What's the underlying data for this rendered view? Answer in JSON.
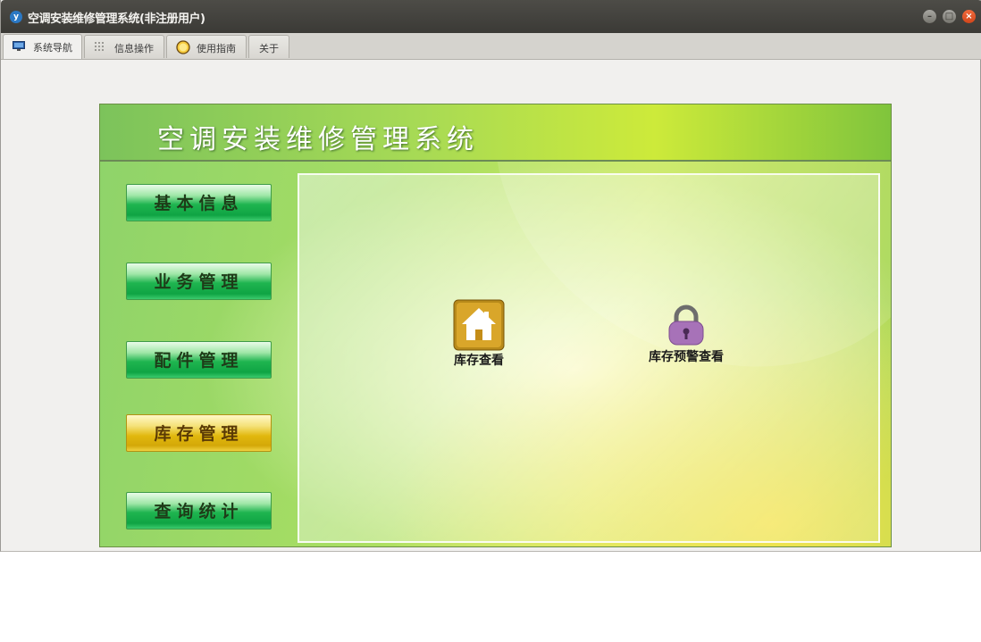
{
  "window": {
    "title": "空调安装维修管理系统(非注册用户)"
  },
  "tabs": [
    {
      "label": "系统导航",
      "icon": "monitor-icon",
      "active": true
    },
    {
      "label": "信息操作",
      "icon": "grid-icon",
      "active": false
    },
    {
      "label": "使用指南",
      "icon": "help-icon",
      "active": false
    },
    {
      "label": "关于",
      "icon": "",
      "active": false
    }
  ],
  "banner": {
    "title": "空调安装维修管理系统"
  },
  "sidebar": {
    "items": [
      {
        "label": "基本信息",
        "active": false
      },
      {
        "label": "业务管理",
        "active": false
      },
      {
        "label": "配件管理",
        "active": false
      },
      {
        "label": "库存管理",
        "active": true
      },
      {
        "label": "查询统计",
        "active": false
      }
    ]
  },
  "content": {
    "items": [
      {
        "label": "库存查看",
        "icon": "house-icon"
      },
      {
        "label": "库存预警查看",
        "icon": "lock-icon"
      }
    ]
  },
  "colors": {
    "active_button": "#e1b80e",
    "button_green": "#1fb550",
    "titlebar": "#3b3a36"
  }
}
